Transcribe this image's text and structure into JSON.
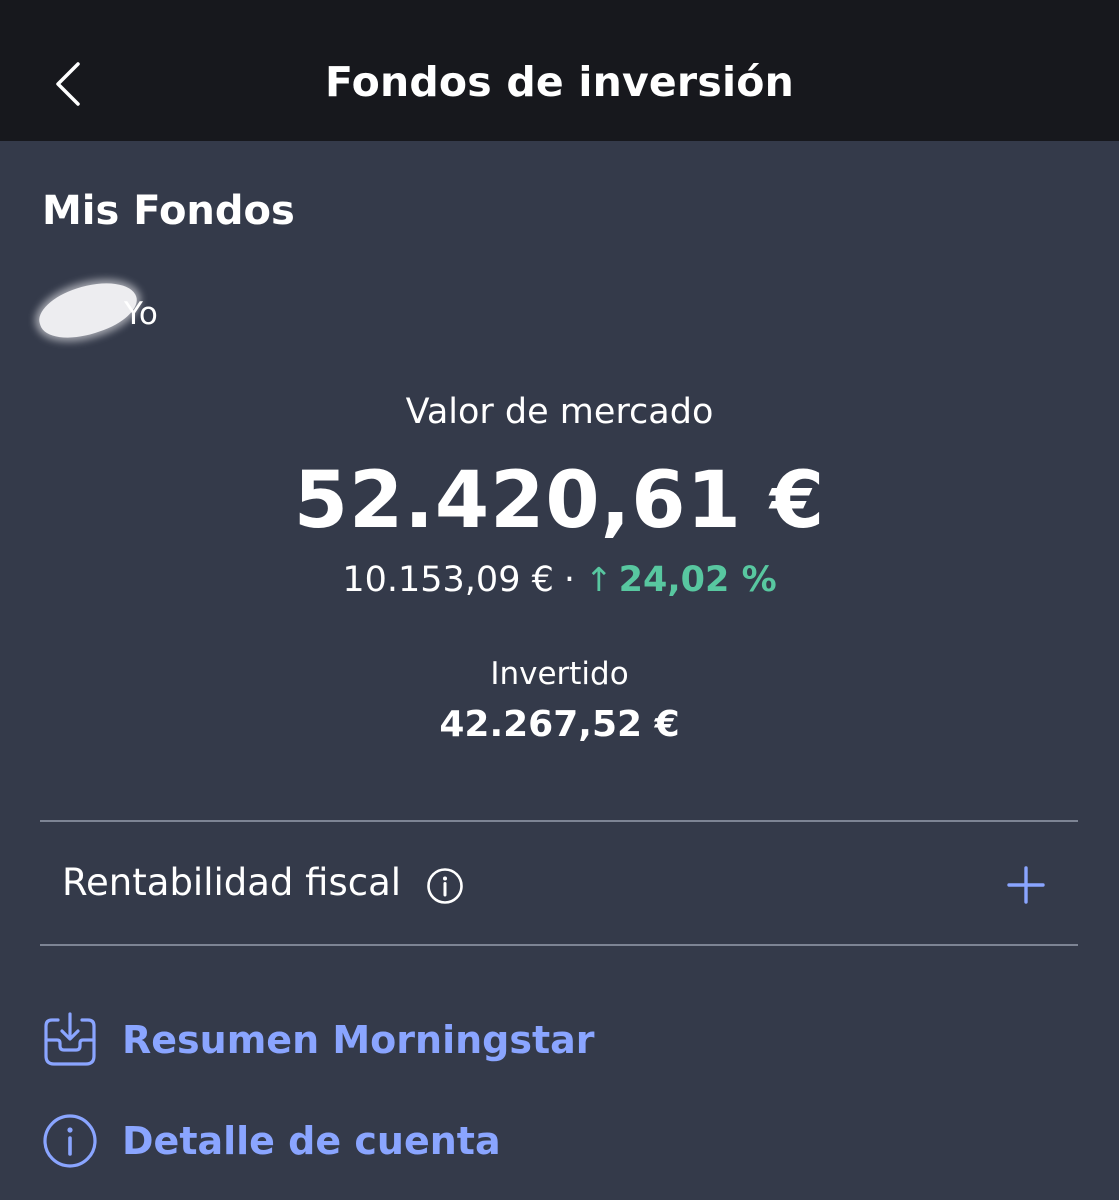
{
  "header": {
    "title": "Fondos de inversión",
    "back_icon": "chevron-left-icon"
  },
  "section": {
    "title": "Mis Fondos"
  },
  "owner": {
    "name": "Yo"
  },
  "summary": {
    "market_label": "Valor de mercado",
    "market_value": "52.420,61 €",
    "gain_amount": "10.153,09 €",
    "separator": "·",
    "gain_arrow": "↑",
    "gain_percent": "24,02 %",
    "invested_label": "Invertido",
    "invested_value": "42.267,52 €"
  },
  "fiscal": {
    "label": "Rentabilidad fiscal",
    "info_icon": "info-circle-icon",
    "expand_icon": "plus-icon"
  },
  "links": {
    "morningstar_label": "Resumen Morningstar",
    "morningstar_icon": "download-tray-icon",
    "account_label": "Detalle de cuenta",
    "account_icon": "info-circle-icon"
  },
  "colors": {
    "background": "#343a4a",
    "header_background": "#17181d",
    "accent_link": "#8aa5ff",
    "positive": "#58c7a0",
    "divider": "#7d8494"
  }
}
